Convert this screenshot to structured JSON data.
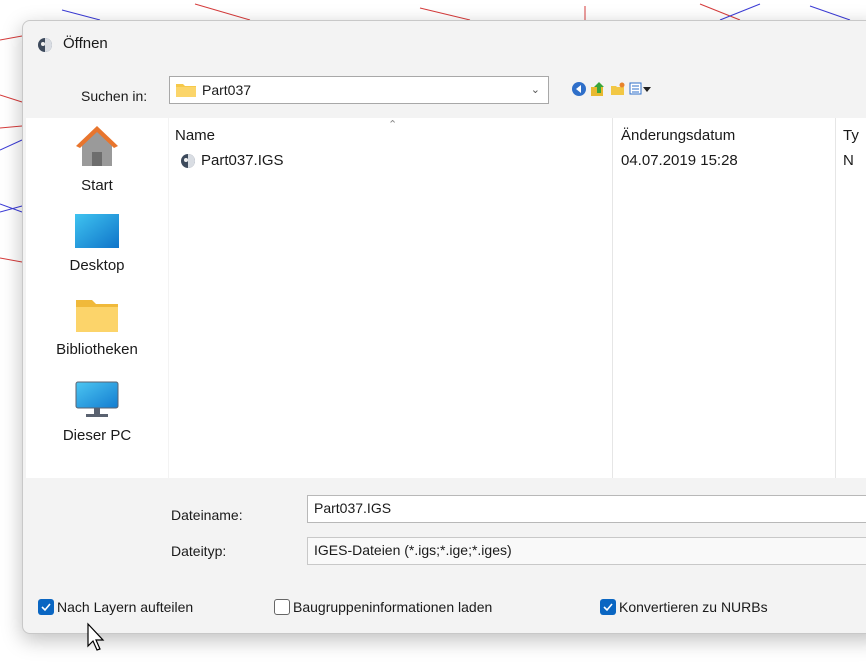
{
  "window": {
    "title": "Öffnen"
  },
  "look_in": {
    "label": "Suchen in:",
    "value": "Part037"
  },
  "places": [
    {
      "label": "Start",
      "icon": "home-icon"
    },
    {
      "label": "Desktop",
      "icon": "desktop-icon"
    },
    {
      "label": "Bibliotheken",
      "icon": "folder-icon"
    },
    {
      "label": "Dieser PC",
      "icon": "monitor-icon"
    }
  ],
  "file_list": {
    "columns": [
      "Name",
      "Änderungsdatum",
      "Ty"
    ],
    "rows": [
      {
        "name": "Part037.IGS",
        "date": "04.07.2019 15:28",
        "type": "N"
      }
    ]
  },
  "filename": {
    "label": "Dateiname:",
    "value": "Part037.IGS"
  },
  "filetype": {
    "label": "Dateityp:",
    "value": "IGES-Dateien (*.igs;*.ige;*.iges)"
  },
  "options": [
    {
      "label": "Nach Layern aufteilen",
      "checked": true
    },
    {
      "label": "Baugruppeninformationen laden",
      "checked": false
    },
    {
      "label": "Konvertieren zu NURBs",
      "checked": true
    }
  ],
  "colors": {
    "accent": "#0a66c2",
    "dialog_bg": "#f3f3f3",
    "folder": "#f6c94a"
  }
}
